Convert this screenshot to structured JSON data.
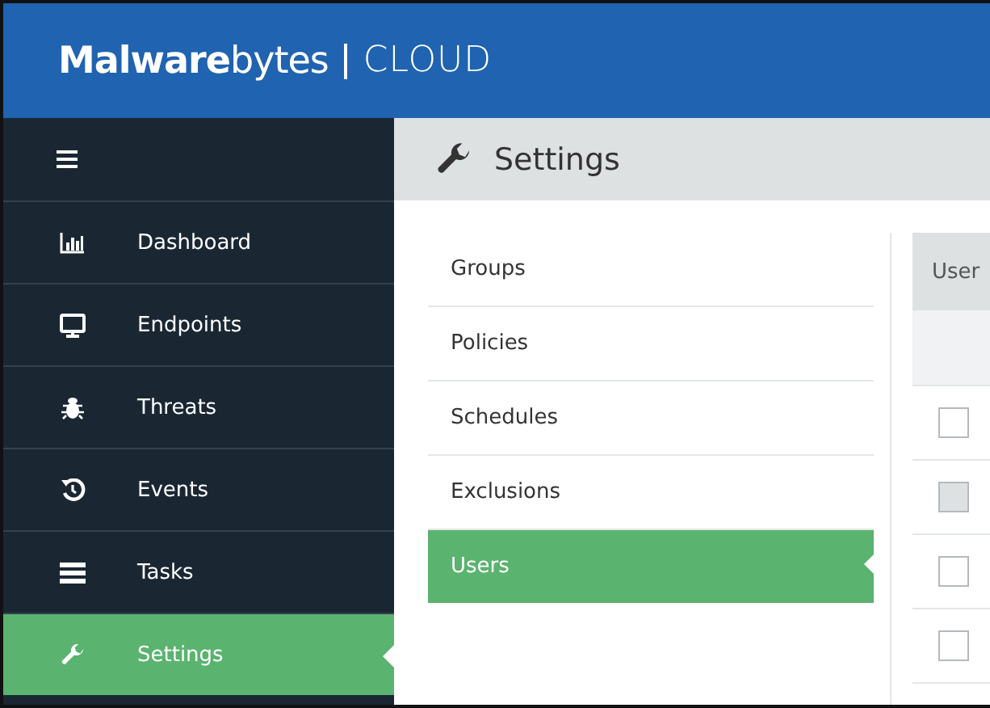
{
  "header": {
    "brand": "**Malware**bytes",
    "product": "CLOUD"
  },
  "page_title": "Settings",
  "sidebar": {
    "items": [
      {
        "label": "Dashboard",
        "selected": false
      },
      {
        "label": "Endpoints",
        "selected": false
      },
      {
        "label": "Threats",
        "selected": false
      },
      {
        "label": "Events",
        "selected": false
      },
      {
        "label": "Tasks",
        "selected": false
      },
      {
        "label": "Settings",
        "selected": true
      }
    ]
  },
  "submenu": [
    {
      "label": "Groups",
      "selected": false
    },
    {
      "label": "Policies",
      "selected": false
    },
    {
      "label": "Schedules",
      "selected": false
    },
    {
      "label": "Exclusions",
      "selected": false
    },
    {
      "label": "Users",
      "selected": true
    }
  ],
  "table": {
    "columns": [
      "User"
    ],
    "rows": [
      {
        "checked": false,
        "disabled": false
      },
      {
        "checked": false,
        "disabled": true
      },
      {
        "checked": false,
        "disabled": false
      },
      {
        "checked": false,
        "disabled": false
      }
    ]
  }
}
